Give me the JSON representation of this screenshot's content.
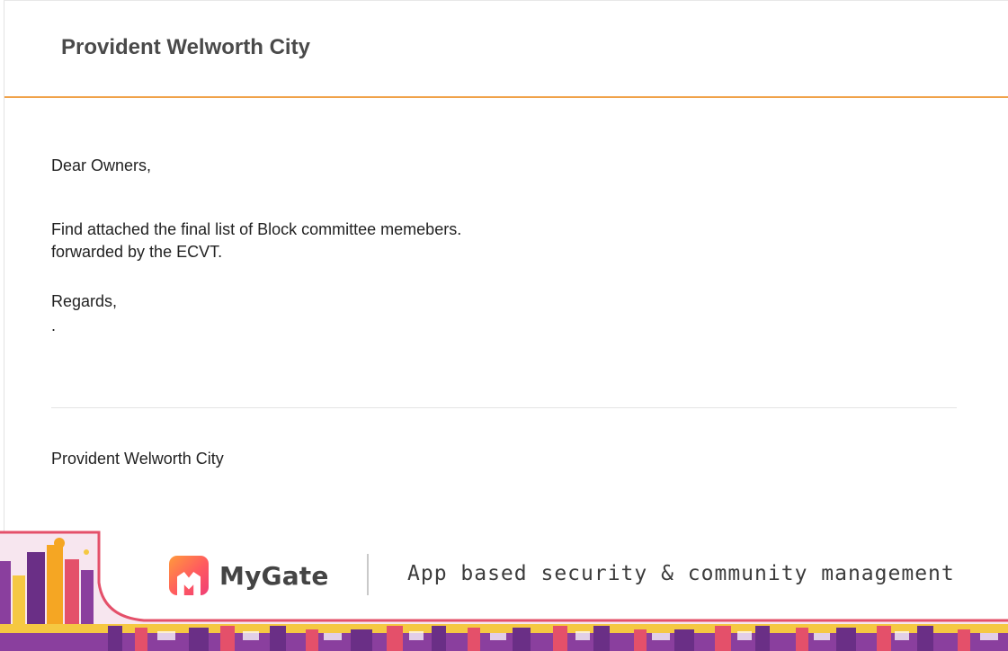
{
  "header": {
    "title": "Provident Welworth City"
  },
  "message": {
    "greeting": "Dear Owners,",
    "line1": "Find attached the final list of Block committee memebers.",
    "line2": "forwarded by the ECVT.",
    "closing": "Regards,",
    "closing_dot": "."
  },
  "signature": {
    "sender": "Provident Welworth City"
  },
  "footer": {
    "brand_name": "MyGate",
    "tagline": "App based security & community management",
    "colors": {
      "orange": "#f5a623",
      "purple": "#8a3f9e",
      "magenta": "#e4506a",
      "yellow": "#f5c842"
    }
  },
  "theme": {
    "accent": "#f0a24a",
    "text": "#222222"
  }
}
